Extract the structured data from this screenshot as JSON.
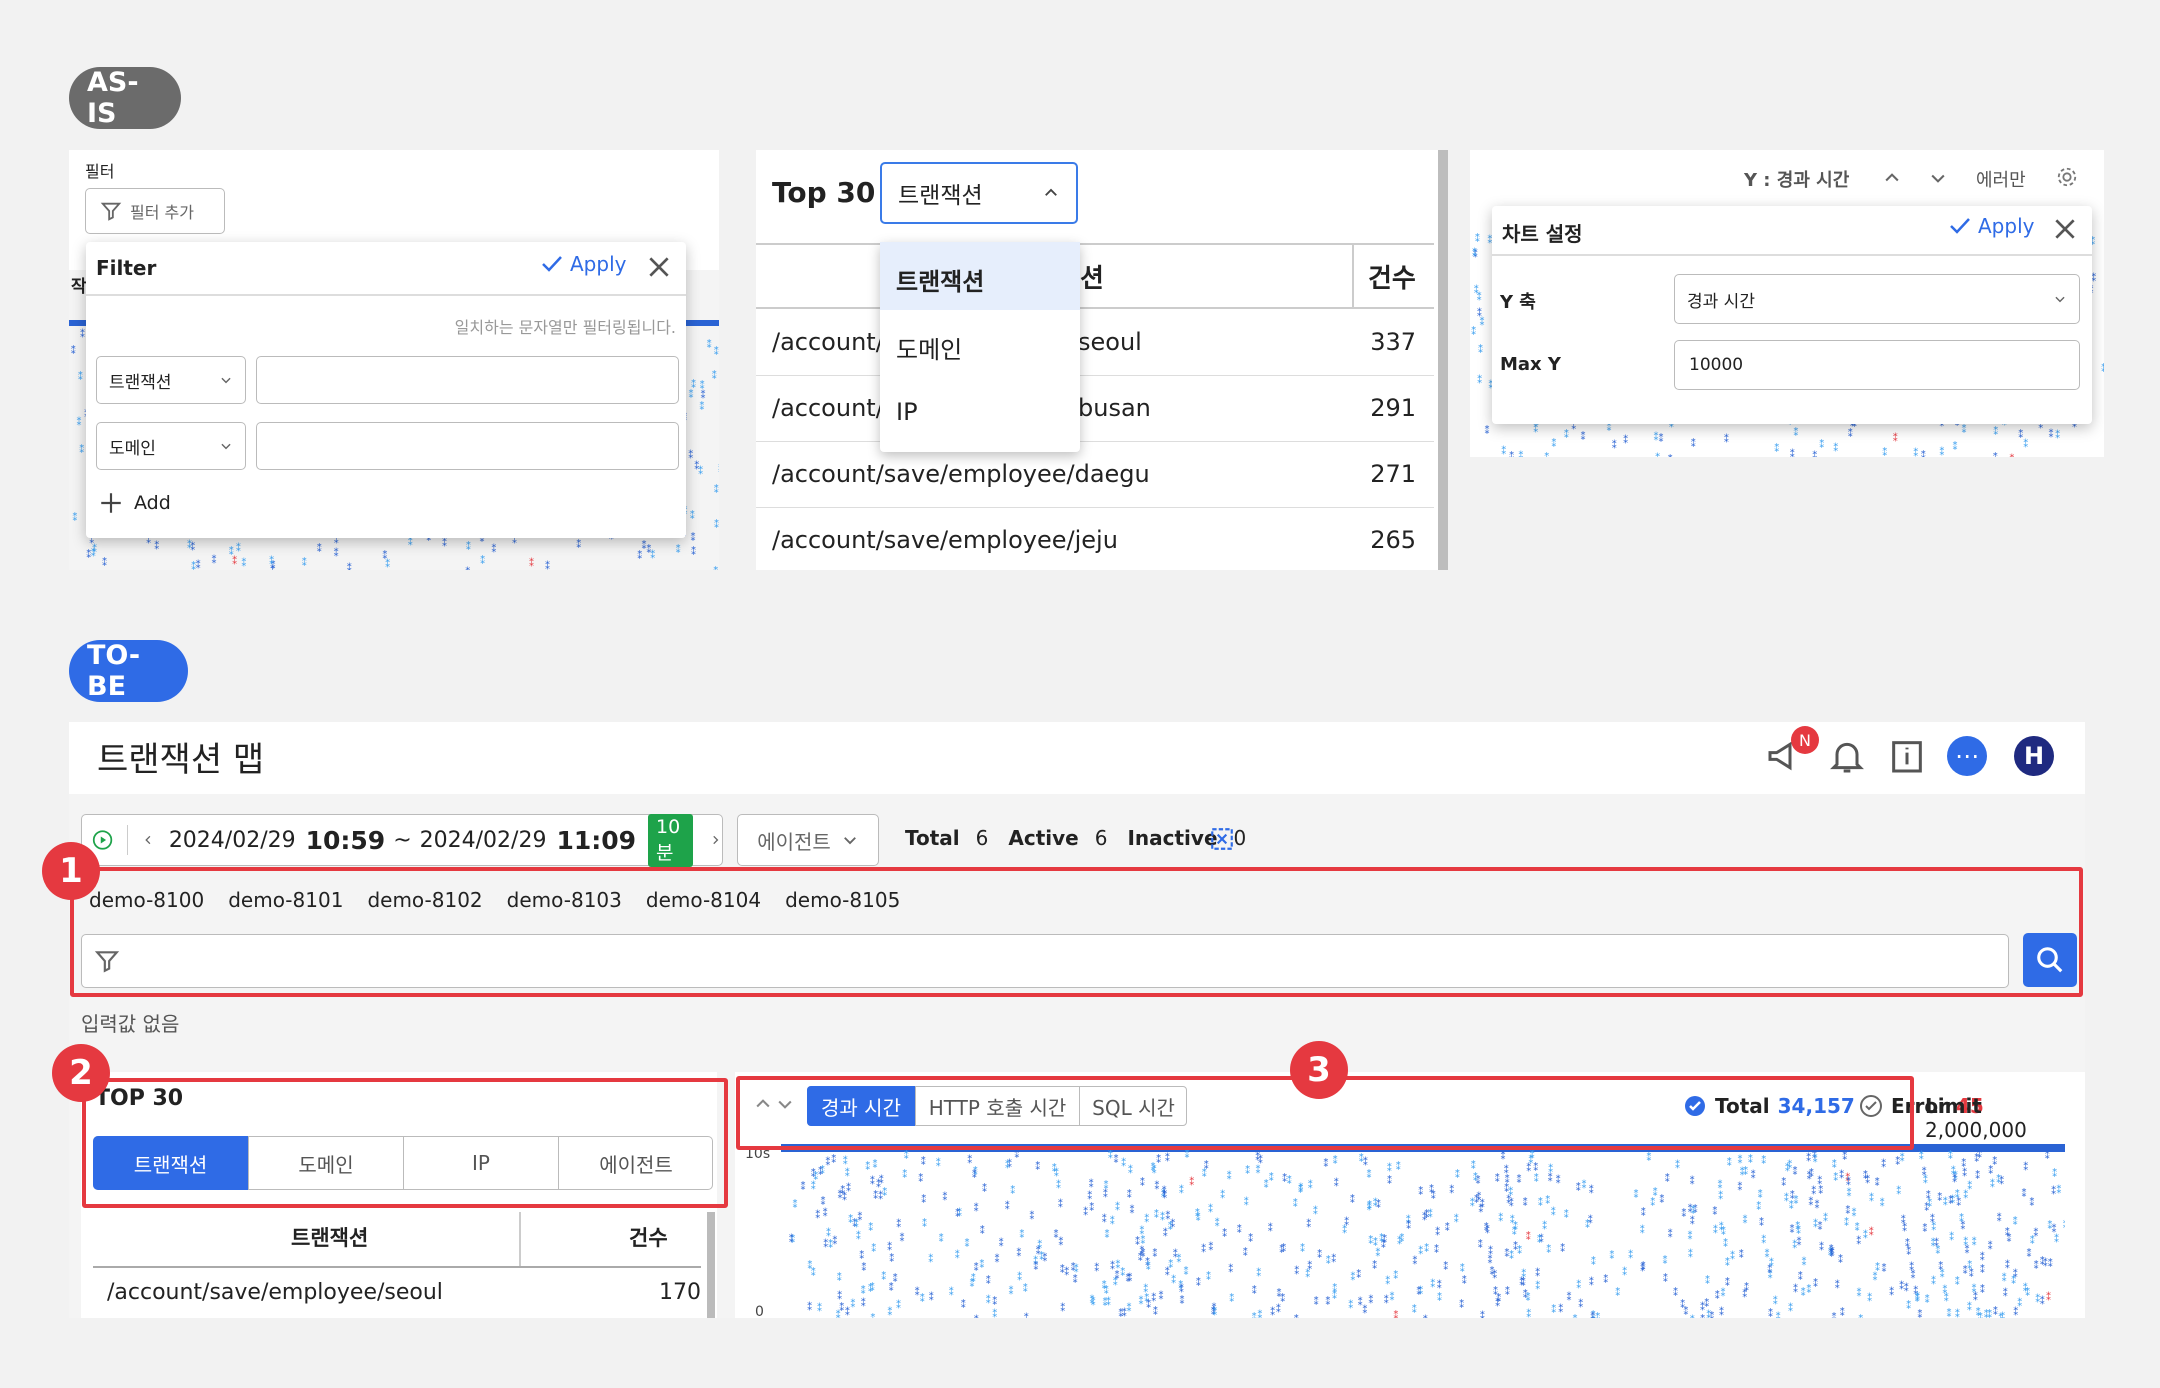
{
  "as_is": {
    "badge": "AS-IS",
    "filter_panel": {
      "section_label": "필터",
      "add_filter_label": "필터 추가",
      "popup_title": "Filter",
      "apply_label": "Apply",
      "hint": "일치하는 문자열만 필터링됩니다.",
      "rows": [
        {
          "select": "트랜잭션",
          "value": ""
        },
        {
          "select": "도메인",
          "value": ""
        }
      ],
      "add_label": "Add",
      "obscured_char": "작"
    },
    "top30_panel": {
      "title": "Top 30",
      "select_value": "트랜잭션",
      "dropdown_options": [
        "트랜잭션",
        "도메인",
        "IP"
      ],
      "col_header_tail": "션",
      "col_count": "건수",
      "rows": [
        {
          "name_left": "/account/",
          "name_right": "seoul",
          "count": "337"
        },
        {
          "name_left": "/account/",
          "name_right": "busan",
          "count": "291"
        },
        {
          "name_left": "/account/save/employee/daegu",
          "name_right": "",
          "count": "271"
        },
        {
          "name_left": "/account/save/employee/jeju",
          "name_right": "",
          "count": "265"
        }
      ]
    },
    "chart_settings_panel": {
      "toolbar_y": "Y : 경과 시간",
      "toolbar_error_only": "에러만",
      "popup_title": "차트 설정",
      "apply_label": "Apply",
      "y_axis_label": "Y 축",
      "y_axis_value": "경과 시간",
      "max_y_label": "Max Y",
      "max_y_value": "10000"
    }
  },
  "to_be": {
    "badge": "TO-BE",
    "app_title": "트랜잭션 맵",
    "notification_badge": "N",
    "avatar_letter": "H",
    "time": {
      "start_date": "2024/02/29",
      "start_time": "10:59",
      "separator": "~",
      "end_date": "2024/02/29",
      "end_time": "11:09",
      "duration": "10분"
    },
    "agent_select": "에이전트",
    "stats": [
      {
        "label": "Total",
        "value": "6"
      },
      {
        "label": "Active",
        "value": "6"
      },
      {
        "label": "Inactive",
        "value": "0"
      }
    ],
    "agents": [
      "demo-8100",
      "demo-8101",
      "demo-8102",
      "demo-8103",
      "demo-8104",
      "demo-8105"
    ],
    "filter_input": {
      "value": "",
      "placeholder": ""
    },
    "input_status": "입력값  없음",
    "markers": [
      "1",
      "2",
      "3"
    ],
    "top30": {
      "title": "TOP 30",
      "tabs": [
        "트랜잭션",
        "도메인",
        "IP",
        "에이전트"
      ],
      "active_tab": "트랜잭션",
      "col_name": "트랜잭션",
      "col_count": "건수",
      "rows": [
        {
          "name": "/account/save/employee/seoul",
          "count": "170"
        }
      ]
    },
    "chart_toolbar": {
      "metric_tabs": [
        "경과 시간",
        "HTTP 호출 시간",
        "SQL 시간"
      ],
      "active_metric": "경과 시간",
      "total_label": "Total",
      "total_value": "34,157",
      "error_label": "Error",
      "error_value": "45",
      "limit_label": "Limit",
      "limit_value": "2,000,000",
      "y_top_tick": "10s",
      "y_bottom_tick": "0"
    }
  },
  "colors": {
    "accent_blue": "#2f6be6",
    "highlight_red": "#e53940",
    "duration_green": "#1ea34a",
    "asis_badge_bg": "#6b6b6b",
    "scatter_blue": "#2a63d4",
    "scatter_light": "#3a9ff0"
  }
}
